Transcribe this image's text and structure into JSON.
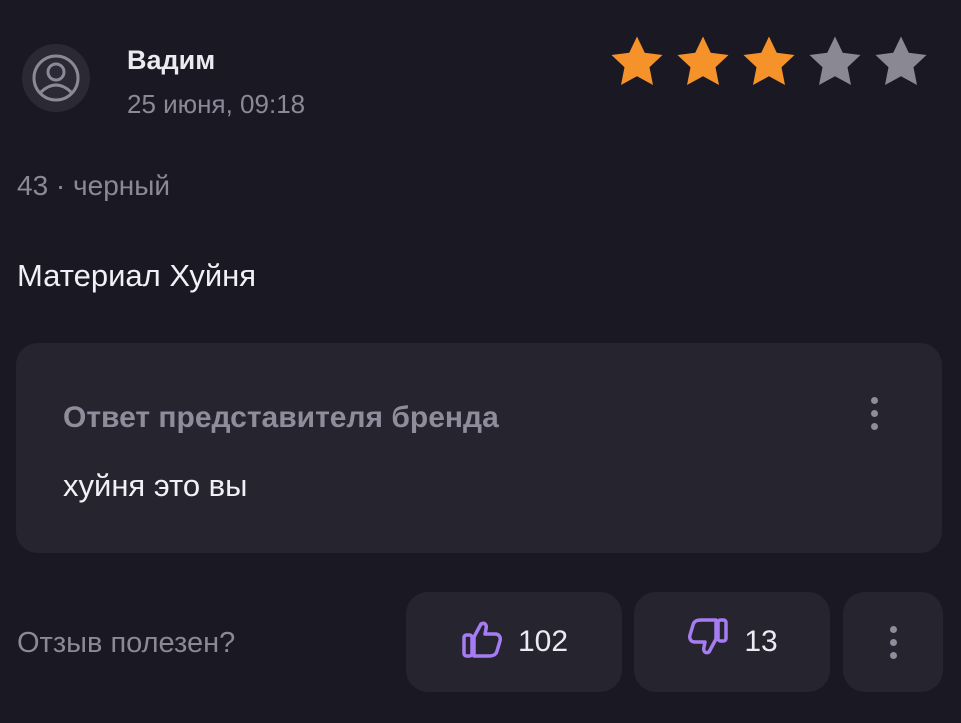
{
  "review": {
    "author": "Вадим",
    "date": "25 июня, 09:18",
    "rating": 3,
    "rating_max": 5,
    "variant": "43 · черный",
    "text": "Материал Хуйня"
  },
  "brand_reply": {
    "title": "Ответ представителя бренда",
    "text": "хуйня это вы"
  },
  "helpful": {
    "label": "Отзыв полезен?",
    "likes": "102",
    "dislikes": "13"
  },
  "colors": {
    "background": "#1a1822",
    "card": "#26242e",
    "star_active": "#f6922a",
    "star_inactive": "#8a8893",
    "accent": "#a57cf2"
  },
  "icons": {
    "avatar": "user-avatar-icon",
    "like": "thumbs-up-icon",
    "dislike": "thumbs-down-icon",
    "menu": "more-vertical-icon"
  }
}
